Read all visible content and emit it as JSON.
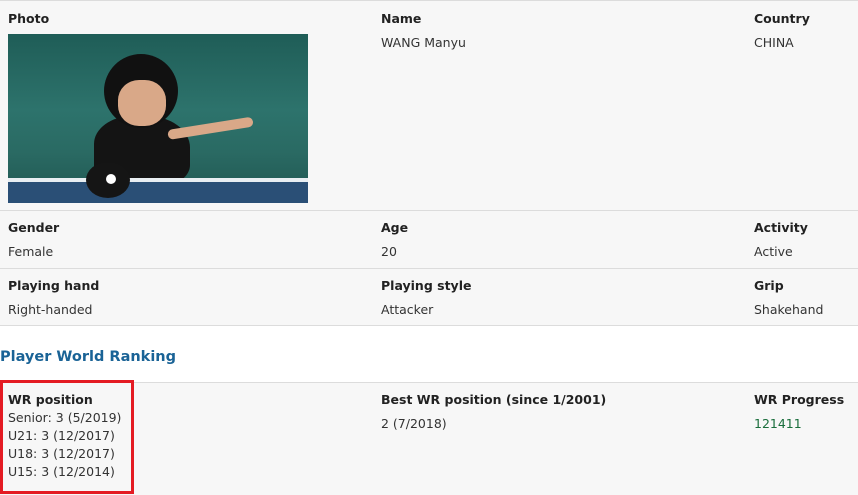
{
  "section1": {
    "photo_label": "Photo",
    "name_label": "Name",
    "name_value": "WANG Manyu",
    "country_label": "Country",
    "country_value": "CHINA"
  },
  "section2": {
    "gender_label": "Gender",
    "gender_value": "Female",
    "age_label": "Age",
    "age_value": "20",
    "activity_label": "Activity",
    "activity_value": "Active"
  },
  "section3": {
    "hand_label": "Playing hand",
    "hand_value": "Right-handed",
    "style_label": "Playing style",
    "style_value": "Attacker",
    "grip_label": "Grip",
    "grip_value": "Shakehand"
  },
  "ranking": {
    "title": "Player World Ranking",
    "wr_label": "WR position",
    "wr_lines": [
      "Senior: 3 (5/2019)",
      "U21: 3 (12/2017)",
      "U18: 3 (12/2017)",
      "U15: 3 (12/2014)"
    ],
    "best_label": "Best WR position (since 1/2001)",
    "best_value": "2 (7/2018)",
    "progress_label": "WR Progress",
    "progress_value": "121411"
  },
  "colors": {
    "section_title": "#1a6396",
    "progress_link": "#1a6e3c",
    "highlight": "#e41b23"
  }
}
